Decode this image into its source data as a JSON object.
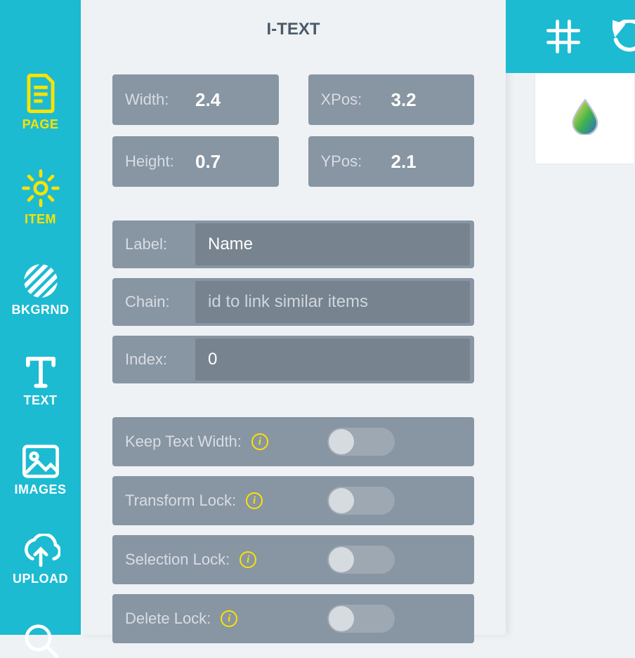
{
  "sidebar": {
    "items": [
      {
        "label": "PAGE",
        "icon": "page"
      },
      {
        "label": "ITEM",
        "icon": "gear",
        "selected": true
      },
      {
        "label": "BKGRND",
        "icon": "stripes"
      },
      {
        "label": "TEXT",
        "icon": "text"
      },
      {
        "label": "IMAGES",
        "icon": "image"
      },
      {
        "label": "UPLOAD",
        "icon": "upload"
      },
      {
        "label": "",
        "icon": "search"
      }
    ]
  },
  "panel": {
    "title": "I-TEXT",
    "props": {
      "width": {
        "label": "Width:",
        "value": "2.4"
      },
      "height": {
        "label": "Height:",
        "value": "0.7"
      },
      "xpos": {
        "label": "XPos:",
        "value": "3.2"
      },
      "ypos": {
        "label": "YPos:",
        "value": "2.1"
      }
    },
    "fields": {
      "label": {
        "label": "Label:",
        "value": "Name"
      },
      "chain": {
        "label": "Chain:",
        "value": "",
        "placeholder": "id to link similar items"
      },
      "index": {
        "label": "Index:",
        "value": "0"
      }
    },
    "toggles": [
      {
        "label": "Keep Text Width:",
        "value": false
      },
      {
        "label": "Transform Lock:",
        "value": false
      },
      {
        "label": "Selection Lock:",
        "value": false
      },
      {
        "label": "Delete Lock:",
        "value": false
      }
    ]
  },
  "topbar": {
    "icons": [
      "grid",
      "undo"
    ]
  }
}
